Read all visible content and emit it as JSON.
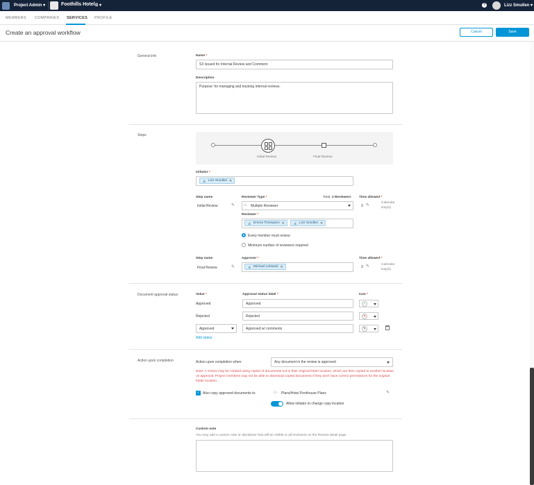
{
  "topbar": {
    "app_name": "Project Admin ▾",
    "project_name": "Foothills Hotel",
    "project_badge": "B ▾",
    "help": "?",
    "user_name": "Lizz Smullen ▾"
  },
  "tabs": [
    {
      "label": "MEMBERS",
      "active": false
    },
    {
      "label": "COMPANIES",
      "active": false
    },
    {
      "label": "SERVICES",
      "active": true
    },
    {
      "label": "PROFILE",
      "active": false
    }
  ],
  "header": {
    "title": "Create an approval workflow",
    "cancel_label": "Cancel",
    "save_label": "Save"
  },
  "general": {
    "section_label": "General info",
    "name_label": "Name",
    "name_value": "S3 Issued for Internal Review and Comment",
    "description_label": "Description",
    "description_value": "Purpose: for managing and tracking internal reviews."
  },
  "steps": {
    "section_label": "Steps",
    "flow_labels": [
      "Initial Review",
      "Final Review"
    ],
    "initiator_label": "Initiator",
    "initiator": "Lizz Smullen",
    "step1": {
      "step_name_label": "Step name",
      "step_name": "Initial Review",
      "reviewer_type_label": "Reviewer Type",
      "reviewer_type": "Multiple Reviewer",
      "total_label": "Total:",
      "total_value": "2 Reviewers",
      "time_allowed_label": "Time allowed",
      "time_allowed_value": "3",
      "time_unit_1": "Calendar",
      "time_unit_2": "Day(s)",
      "reviewer_label": "Reviewer",
      "reviewers": [
        "Emma Thompson",
        "Lizz Smullen"
      ],
      "option_all": "Every member must review",
      "option_min": "Minimum number of reviewers required"
    },
    "step2": {
      "step_name_label": "Step name",
      "step_name": "Final Review",
      "approver_label": "Approver",
      "approver": "Michael Lebsack",
      "time_allowed_label": "Time allowed",
      "time_allowed_value": "3",
      "time_unit_1": "Calendar",
      "time_unit_2": "Day(s)"
    }
  },
  "status": {
    "section_label": "Document approval status",
    "value_label": "Value",
    "approval_label_header": "Approval status label",
    "icon_label": "Icon",
    "rows": [
      {
        "value": "Approved",
        "label": "Approved",
        "glyph": "✓",
        "glyph_color": "#3a9a3a"
      },
      {
        "value": "Rejected",
        "label": "Rejected",
        "glyph": "✕",
        "glyph_color": "#d74e26"
      },
      {
        "value": "Approved",
        "label": "Approved w/ comments",
        "glyph": "✎",
        "glyph_color": "#555555"
      }
    ],
    "add_status": "Add status"
  },
  "completion": {
    "section_label": "Action upon completion",
    "when_label": "Action upon completion when:",
    "when_value": "Any document in the review is approved",
    "note": "Note: A review may be created using copies of documents not in their original folder location, which are then copied to another location on approval. Project members may not be able to download copied documents if they don't have correct permissions for the original folder location.",
    "copy_label": "Also copy approved documents to:",
    "copy_path": "Plans/Hotel Penthouse Plans",
    "toggle_label": "Allow initiator to change copy location"
  },
  "custom_note": {
    "label": "Custom note",
    "help": "You may add a custom note or disclaimer that will be visible to all reviewers on the Review detail page."
  },
  "colors": {
    "topbar": "#152339",
    "accent": "#0696d7",
    "danger": "#e0474c"
  }
}
